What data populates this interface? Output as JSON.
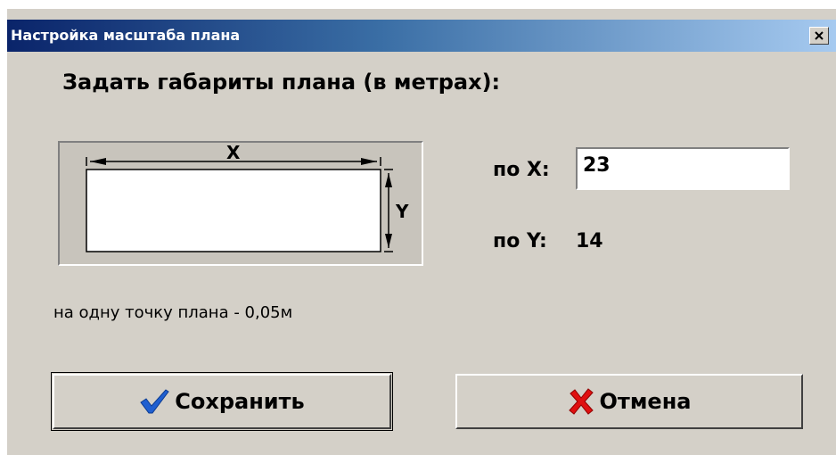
{
  "window": {
    "title": "Настройка масштаба плана"
  },
  "heading": "Задать габариты плана (в метрах):",
  "diagram": {
    "x_label": "X",
    "y_label": "Y"
  },
  "fields": {
    "x_label": "по X:",
    "x_value": "23",
    "y_label": "по Y:",
    "y_value": "14"
  },
  "scale": {
    "text": "на одну точку плана -  0,05м"
  },
  "buttons": {
    "save_label": "Сохранить",
    "save_icon": "checkmark-icon",
    "cancel_label": "Отмена",
    "cancel_icon": "red-x-icon"
  },
  "colors": {
    "window_bg": "#d4d0c8",
    "title_start": "#0a246a",
    "title_end": "#a6caf0",
    "check_blue": "#1f5fd0",
    "cancel_red": "#e01010"
  }
}
